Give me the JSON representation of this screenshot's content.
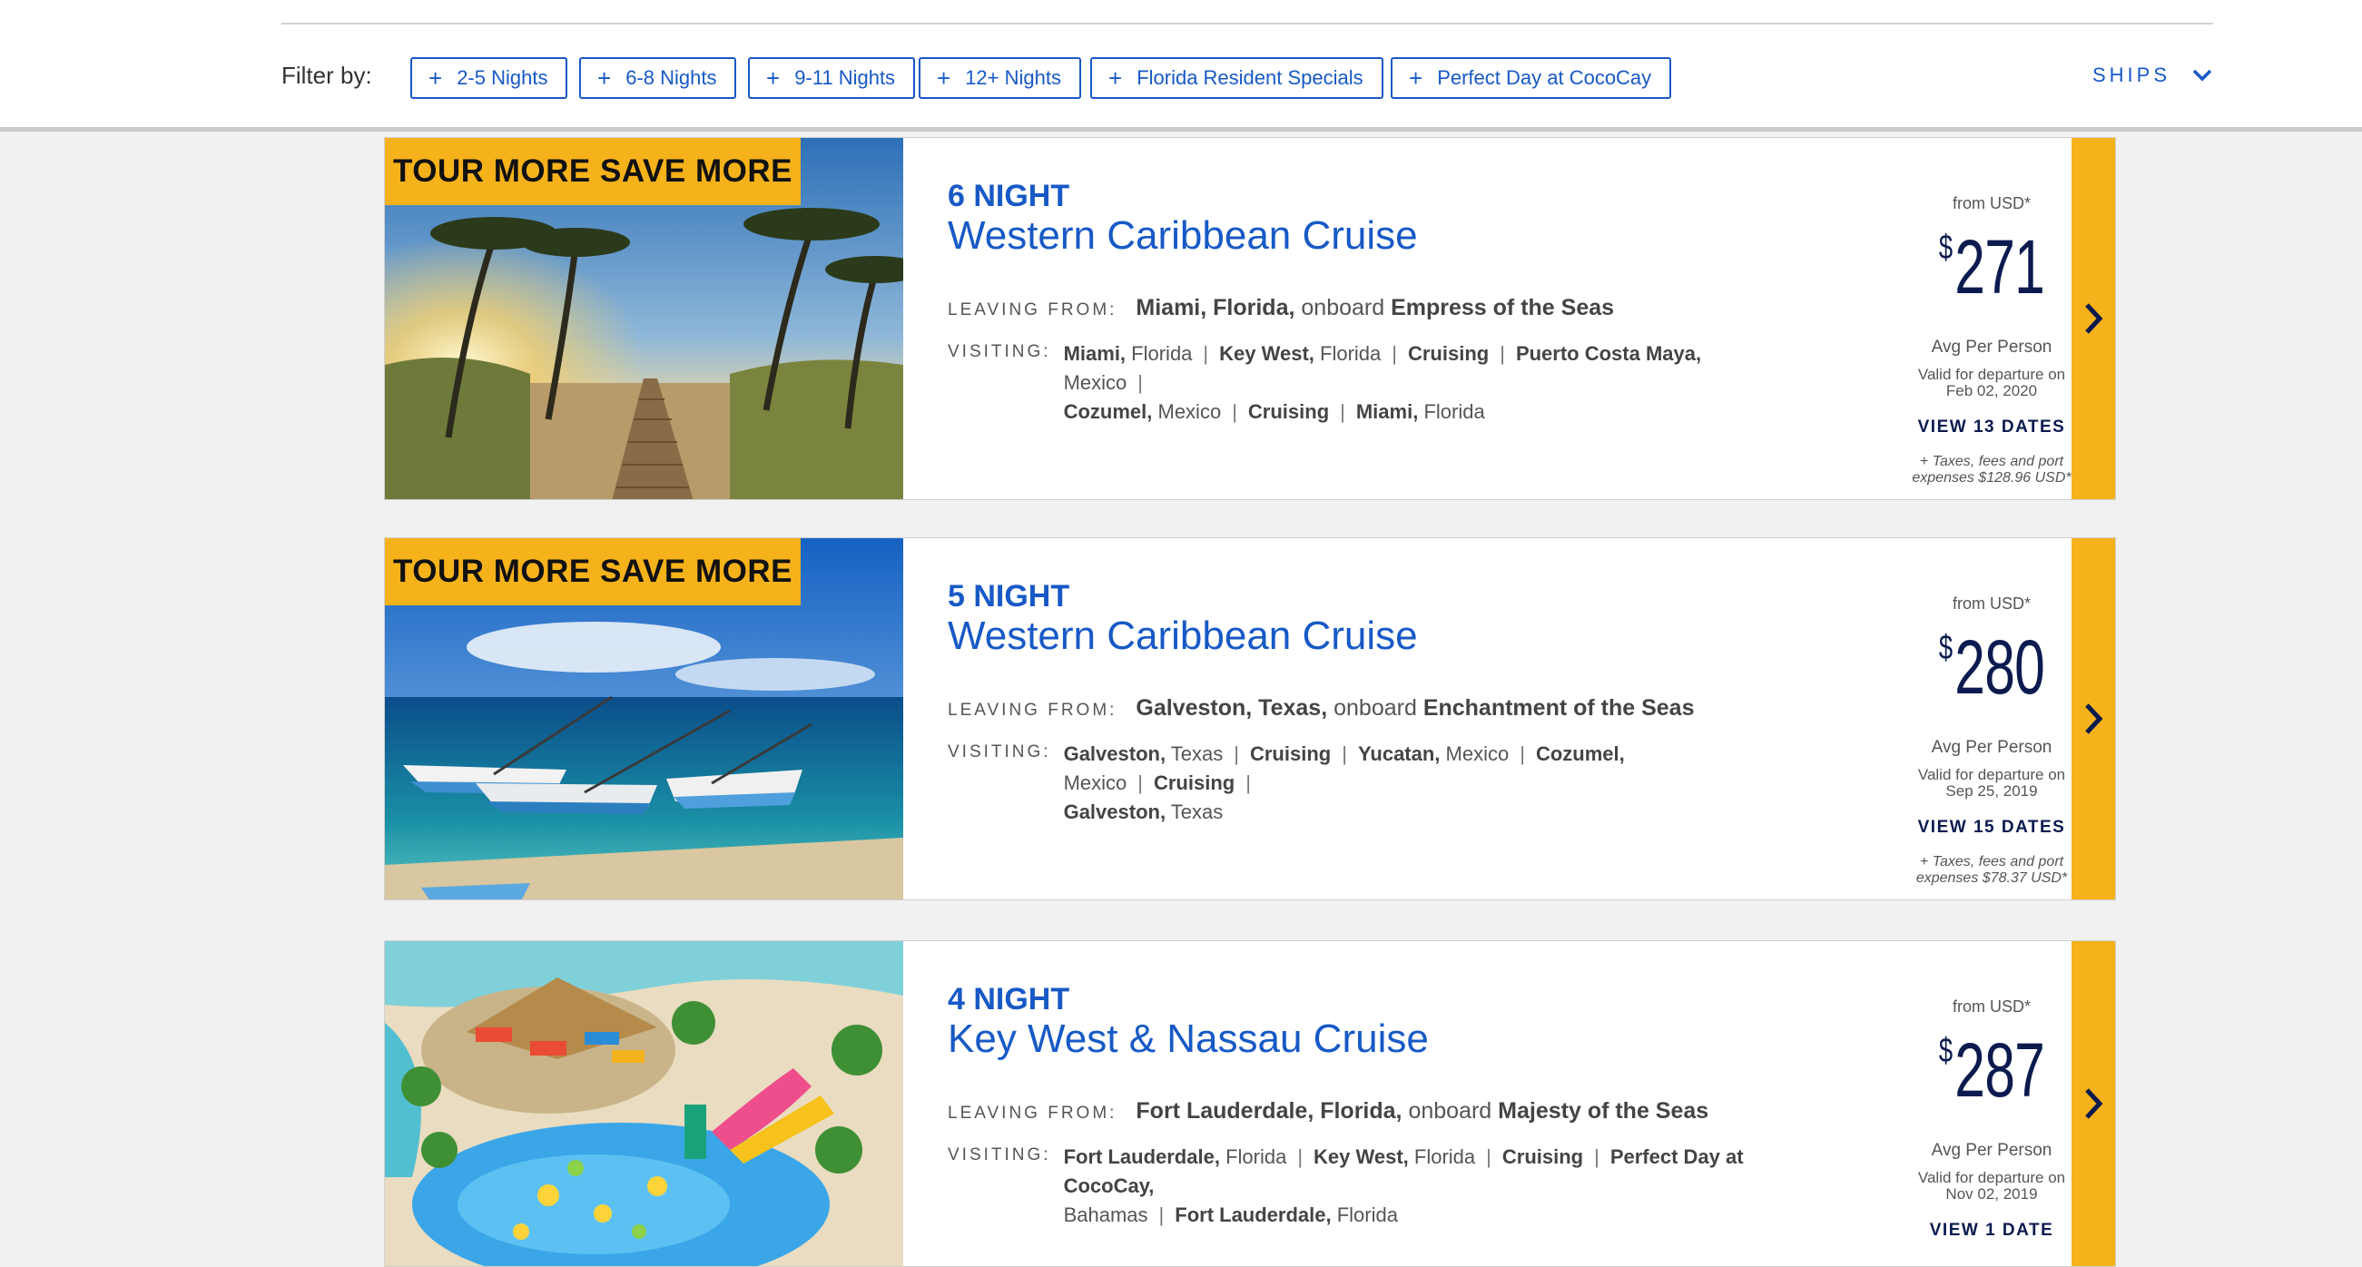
{
  "filter": {
    "label": "Filter by:",
    "chips": [
      "2-5 Nights",
      "6-8 Nights",
      "9-11 Nights",
      "12+ Nights",
      "Florida Resident Specials",
      "Perfect Day at CocoCay"
    ],
    "ships_label": "SHIPS"
  },
  "cruises": [
    {
      "badge": "TOUR MORE SAVE MORE",
      "nights": "6 NIGHT",
      "title": "Western Caribbean Cruise",
      "leaving_label": "LEAVING FROM:",
      "leaving_port": "Miami, Florida,",
      "onboard": "onboard",
      "ship": "Empress of the Seas",
      "visiting_label": "VISITING:",
      "ports": [
        {
          "name": "Miami,",
          "region": "Florida"
        },
        {
          "name": "Key West,",
          "region": "Florida"
        },
        {
          "name": "Cruising",
          "region": ""
        },
        {
          "name": "Puerto Costa Maya,",
          "region": "Mexico"
        },
        {
          "name": "Cozumel,",
          "region": "Mexico"
        },
        {
          "name": "Cruising",
          "region": ""
        },
        {
          "name": "Miami,",
          "region": "Florida"
        }
      ],
      "from": "from USD*",
      "currency": "$",
      "price": "271",
      "avg": "Avg Per Person",
      "valid_line1": "Valid for departure on",
      "valid_line2": "Feb 02, 2020",
      "view_dates": "VIEW 13 DATES",
      "taxes_line1": "+ Taxes, fees and port",
      "taxes_line2": "expenses $128.96 USD*"
    },
    {
      "badge": "TOUR MORE SAVE MORE",
      "nights": "5 NIGHT",
      "title": "Western Caribbean Cruise",
      "leaving_label": "LEAVING FROM:",
      "leaving_port": "Galveston, Texas,",
      "onboard": "onboard",
      "ship": "Enchantment of the Seas",
      "visiting_label": "VISITING:",
      "ports": [
        {
          "name": "Galveston,",
          "region": "Texas"
        },
        {
          "name": "Cruising",
          "region": ""
        },
        {
          "name": "Yucatan,",
          "region": "Mexico"
        },
        {
          "name": "Cozumel,",
          "region": "Mexico"
        },
        {
          "name": "Cruising",
          "region": ""
        },
        {
          "name": "Galveston,",
          "region": "Texas"
        }
      ],
      "from": "from USD*",
      "currency": "$",
      "price": "280",
      "avg": "Avg Per Person",
      "valid_line1": "Valid for departure on",
      "valid_line2": "Sep 25, 2019",
      "view_dates": "VIEW 15 DATES",
      "taxes_line1": "+ Taxes, fees and port",
      "taxes_line2": "expenses $78.37 USD*"
    },
    {
      "badge": "",
      "nights": "4 NIGHT",
      "title": "Key West & Nassau Cruise",
      "leaving_label": "LEAVING FROM:",
      "leaving_port": "Fort Lauderdale, Florida,",
      "onboard": "onboard",
      "ship": "Majesty of the Seas",
      "visiting_label": "VISITING:",
      "ports": [
        {
          "name": "Fort Lauderdale,",
          "region": "Florida"
        },
        {
          "name": "Key West,",
          "region": "Florida"
        },
        {
          "name": "Cruising",
          "region": ""
        },
        {
          "name": "Perfect Day at CocoCay,",
          "region": "Bahamas"
        },
        {
          "name": "Fort Lauderdale,",
          "region": "Florida"
        }
      ],
      "from": "from USD*",
      "currency": "$",
      "price": "287",
      "avg": "Avg Per Person",
      "valid_line1": "Valid for departure on",
      "valid_line2": "Nov 02, 2019",
      "view_dates": "VIEW 1 DATE",
      "taxes_line1": "",
      "taxes_line2": ""
    }
  ],
  "colors": {
    "brand_blue": "#1759c6",
    "navy": "#0b1a4f",
    "badge_yellow": "#f6b21b"
  },
  "icons": {
    "filter_chip": "plus-icon",
    "ships": "chevron-down-icon",
    "card_nav": "chevron-right-icon"
  }
}
